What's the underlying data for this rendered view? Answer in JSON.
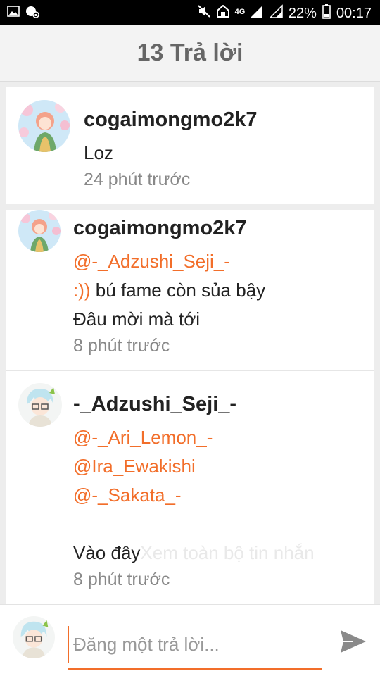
{
  "status_bar": {
    "network": "4G",
    "battery": "22%",
    "time": "00:17",
    "icons": [
      "image-icon",
      "vpn-icon",
      "mute-icon",
      "home-icon",
      "signal-icon",
      "signal-icon-2",
      "battery-icon"
    ]
  },
  "header": {
    "title": "13 Trả lời"
  },
  "comments": [
    {
      "username": "cogaimongmo2k7",
      "lines": [
        "Loz"
      ],
      "time": "24 phút trước"
    },
    {
      "username": "cogaimongmo2k7",
      "mentions": [
        "@-_Adzushi_Seji_-"
      ],
      "emote": ":))",
      "lines": [
        "bú fame còn sủa bậy",
        "Đâu mời mà tới"
      ],
      "time": "8 phút trước"
    },
    {
      "username": "-_Adzushi_Seji_-",
      "mentions": [
        "@-_Ari_Lemon_-",
        "@Ira_Ewakishi",
        "@-_Sakata_-"
      ],
      "lines": [
        "Vào đây"
      ],
      "ghost_text": "Xem toàn bộ tin nhắn",
      "time": "8 phút trước"
    }
  ],
  "reply": {
    "placeholder": "Đăng một trả lời..."
  },
  "colors": {
    "accent": "#f26e2a",
    "header_bg": "#f3f3f3",
    "status_bar": "#000000"
  }
}
